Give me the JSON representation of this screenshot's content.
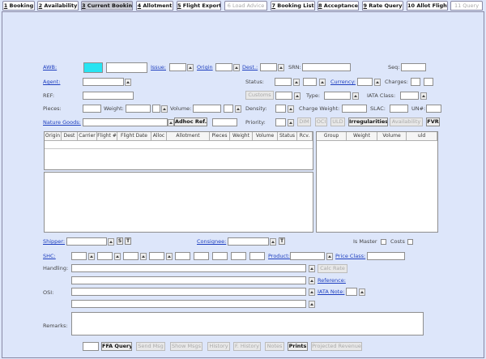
{
  "tabs": [
    {
      "num": "1",
      "label": "Booking"
    },
    {
      "num": "2",
      "label": "Availability"
    },
    {
      "num": "3",
      "label": "Current Booking"
    },
    {
      "num": "4",
      "label": "Allotment"
    },
    {
      "num": "5",
      "label": "Flight Export"
    },
    {
      "num": "6",
      "label": "Load Advice"
    },
    {
      "num": "7",
      "label": "Booking List"
    },
    {
      "num": "8",
      "label": "Acceptance"
    },
    {
      "num": "9",
      "label": "Rate Query"
    },
    {
      "num": "10",
      "label": "Allot Flight"
    },
    {
      "num": "11",
      "label": "Query"
    }
  ],
  "labels": {
    "awb": "AWB:",
    "issue": "Issue:",
    "origin": "Origin",
    "dest": "Dest.:",
    "srn": "SRN:",
    "seq": "Seq:",
    "agent": "Agent:",
    "status": "Status:",
    "currency": "Currency:",
    "charges": "Charges:",
    "ref": "REF:",
    "type": "Type:",
    "iata_class": "IATA Class:",
    "pieces": "Pieces:",
    "weight": "Weight:",
    "volume": "Volume:",
    "density": "Density:",
    "charge_weight": "Charge Weight:",
    "slac": "SLAC:",
    "un": "UN#:",
    "nature_goods": "Nature Goods:",
    "priority": "Priority:",
    "shipper": "Shipper:",
    "consignee": "Consignee:",
    "is_master": "Is Master",
    "costs": "Costs",
    "shc": "SHC:",
    "product": "Product:",
    "price_class": "Price Class:",
    "handling": "Handling:",
    "reference": "Reference:",
    "osi": "OSI:",
    "iata_note": "IATA Note:",
    "remarks": "Remarks:"
  },
  "buttons": {
    "customs": "Customs",
    "adhoc_ref": "Adhoc Ref.",
    "dim": "DIM",
    "oci": "OCI",
    "uld": "ULD",
    "irregularities": "Irregularities",
    "availability": "Availability",
    "fvr": "FVR",
    "s": "S",
    "t": "T",
    "calc_rate": "Calc Rate",
    "ffa_query": "FFA Query",
    "send_msg": "Send Msg",
    "show_msgs": "Show Msgs",
    "history": "History",
    "f_history": "F. History",
    "notes": "Notes",
    "prints": "Prints",
    "projected_revenue": "Projected Revenue"
  },
  "flight_table": {
    "columns": [
      "Origin",
      "Dest",
      "Carrier",
      "Flight #",
      "Flight Date",
      "Alloc",
      "Allotment",
      "Pieces",
      "Weight",
      "Volume",
      "Status",
      "Rcv."
    ]
  },
  "uld_table": {
    "columns": [
      "Group",
      "Weight",
      "Volume",
      "uld"
    ]
  },
  "colors": {
    "background": "#dde6fa",
    "awb_prefix": "#27e4f2",
    "link": "#1e3fbf"
  }
}
